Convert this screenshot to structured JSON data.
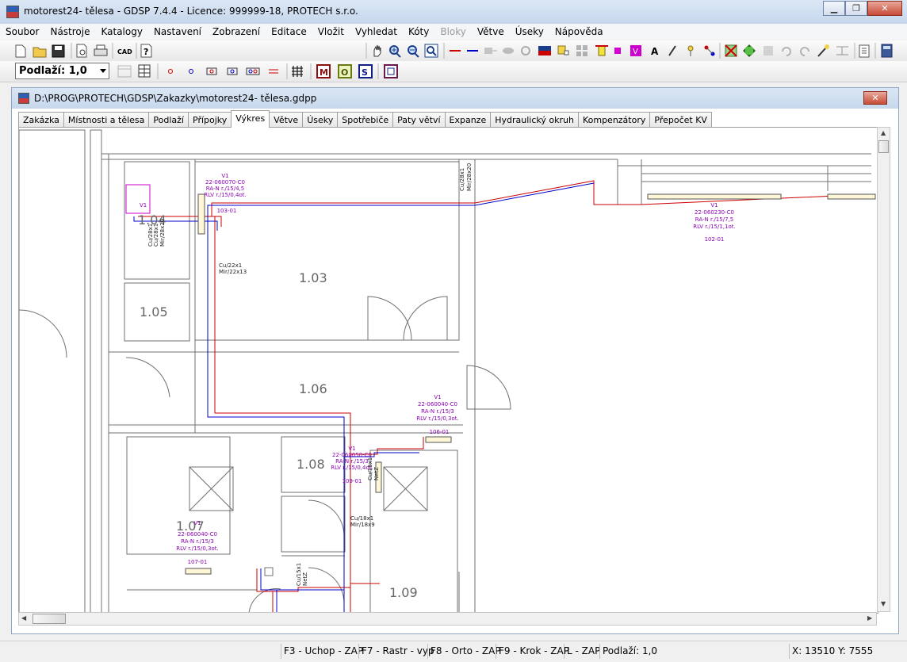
{
  "window": {
    "title": "motorest24- tělesa - GDSP 7.4.4 -  Licence: 999999-18, PROTECH s.r.o.",
    "app_icon": "gdsp-app-icon"
  },
  "menu": [
    "Soubor",
    "Nástroje",
    "Katalogy",
    "Nastavení",
    "Zobrazení",
    "Editace",
    "Vložit",
    "Vyhledat",
    "Kóty",
    "Bloky",
    "Větve",
    "Úseky",
    "Nápověda"
  ],
  "menu_disabled": [
    "Bloky"
  ],
  "toolbar": {
    "cad_label": "CAD",
    "floor_select": "Podlaží: 1,0",
    "letter_m": "M",
    "letter_o": "O",
    "letter_s": "S",
    "letter_v": "V",
    "letter_a": "A"
  },
  "document": {
    "path": "D:\\PROG\\PROTECH\\GDSP\\Zakazky\\motorest24- tělesa.gdpp",
    "tabs": [
      "Zakázka",
      "Místnosti a tělesa",
      "Podlaží",
      "Přípojky",
      "Výkres",
      "Větve",
      "Úseky",
      "Spotřebiče",
      "Paty větví",
      "Expanze",
      "Hydraulický okruh",
      "Kompenzátory",
      "Přepočet KV"
    ],
    "active_tab": "Výkres"
  },
  "drawing": {
    "rooms": [
      "1.04",
      "1.05",
      "1.03",
      "1.06",
      "1.08",
      "1.07",
      "1.09"
    ],
    "radiators": [
      {
        "v": "V1",
        "code": "22-060070-C0",
        "valve": "RA-N r./15/4,5",
        "rlv": "RLV r./15/0,4ot.",
        "id": "103-01"
      },
      {
        "v": "V1",
        "code": "22-060230-C0",
        "valve": "RA-N r./15/7,5",
        "rlv": "RLV r./15/1,1ot.",
        "id": "102-01"
      },
      {
        "v": "V1",
        "code": "22-060040-C0",
        "valve": "RA-N r./15/3",
        "rlv": "RLV r./15/0,3ot.",
        "id": "106-01"
      },
      {
        "v": "V1",
        "code": "22-060050-C0",
        "valve": "RA-N r./15/3",
        "rlv": "RLV r./15/0,4ot.",
        "id": "109-01"
      },
      {
        "v": "V1",
        "code": "22-060040-C0",
        "valve": "RA-N r./15/3",
        "rlv": "RLV r./15/0,3ot.",
        "id": "107-01"
      }
    ],
    "pipes": {
      "p1a": "Cu/22x1",
      "p1b": "Mir/22x13",
      "p2a": "Cu/18x1",
      "p2b": "Mir/18x9",
      "p3a": "Cu/28x1",
      "p3b": "Mir/28x20",
      "p4a": "Cu/28x1",
      "p4b": "Cu/28x1",
      "p4c": "Mir/28x20",
      "p5a": "Cu/15x1",
      "p5b": "NetZ",
      "p6a": "Cu/15x1",
      "p6b": "NetZ"
    },
    "v1_small": "V1"
  },
  "status": {
    "f3": "F3 - Uchop - ZAP",
    "f7": "F7 - Rastr - vyp",
    "f8": "F8 - Orto - ZAP",
    "f9": "F9 - Krok - ZAP",
    "l": "L - ZAP",
    "floor": "Podlaží: 1,0",
    "coords": "X: 13510 Y: 7555"
  },
  "colors": {
    "supply": "#cc0000",
    "return": "#0000cc",
    "label": "#8b00b4",
    "radiator_fill": "#fff8d8",
    "wall": "#707070"
  }
}
